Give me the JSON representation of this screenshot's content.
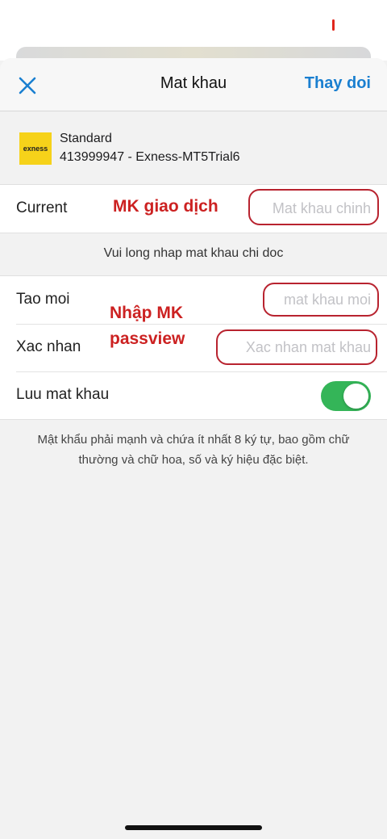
{
  "nav": {
    "close_icon": "close-icon",
    "title": "Mat khau",
    "action_label": "Thay doi",
    "accent_color": "#1a7fd0"
  },
  "account": {
    "logo_text": "exness",
    "type": "Standard",
    "id": "413999947 - Exness-MT5Trial6"
  },
  "current": {
    "label": "Current",
    "placeholder": "Mat khau chinh",
    "value": ""
  },
  "hint": "Vui long nhap mat khau chi doc",
  "new_password": {
    "label": "Tao moi",
    "placeholder": "mat khau moi",
    "value": ""
  },
  "confirm": {
    "label": "Xac nhan",
    "placeholder": "Xac nhan mat khau",
    "value": ""
  },
  "save_password": {
    "label": "Luu mat khau",
    "enabled": true,
    "color": "#34b558"
  },
  "note": "Mật khẩu phải mạnh và chứa ít nhất 8 ký tự, bao gồm chữ thường và chữ hoa, số và ký hiệu đặc biệt.",
  "annotations": {
    "current_note": "MK giao dịch",
    "new_note_line1": "Nhập MK",
    "new_note_line2": "passview",
    "color": "#cc2121"
  }
}
